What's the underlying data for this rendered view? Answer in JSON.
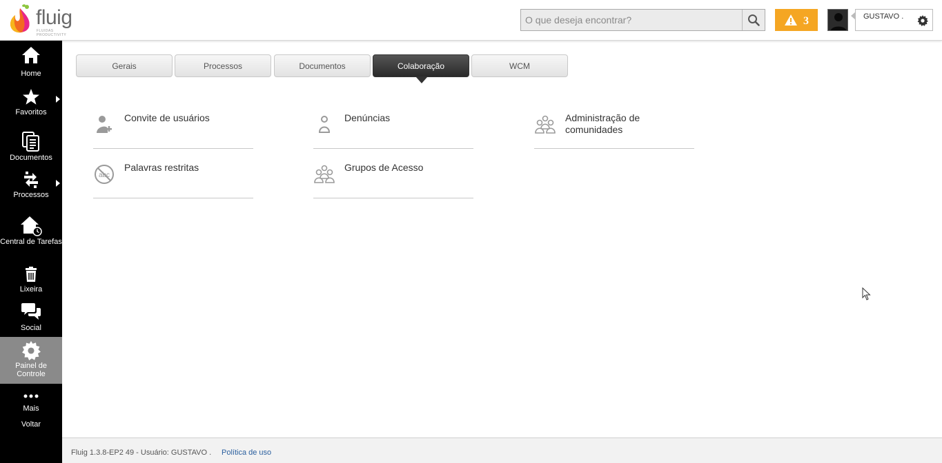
{
  "header": {
    "logo_text": "fluig",
    "logo_subtext": "FLUIDAS PRODUCTIVITY",
    "search_placeholder": "O que deseja encontrar?",
    "alert_count": "3",
    "user_name": "GUSTAVO ."
  },
  "sidebar": {
    "items": [
      {
        "label": "Home",
        "icon": "home-icon"
      },
      {
        "label": "Favoritos",
        "icon": "star-icon"
      },
      {
        "label": "Documentos",
        "icon": "documents-icon"
      },
      {
        "label": "Processos",
        "icon": "processes-icon"
      },
      {
        "label": "Central de Tarefas",
        "icon": "task-center-icon"
      },
      {
        "label": "Lixeira",
        "icon": "trash-icon"
      },
      {
        "label": "Social",
        "icon": "social-icon"
      },
      {
        "label": "Painel de Controle",
        "icon": "gear-icon"
      },
      {
        "label": "Mais",
        "icon": "more-icon"
      },
      {
        "label": "Voltar",
        "icon": ""
      }
    ]
  },
  "tabs": [
    {
      "label": "Gerais"
    },
    {
      "label": "Processos"
    },
    {
      "label": "Documentos"
    },
    {
      "label": "Colaboração",
      "active": true
    },
    {
      "label": "WCM"
    }
  ],
  "items": [
    {
      "label": "Convite de usuários",
      "icon": "user-add-icon"
    },
    {
      "label": "Denúncias",
      "icon": "user-icon"
    },
    {
      "label": "Administração de comunidades",
      "icon": "community-icon"
    },
    {
      "label": "Palavras restritas",
      "icon": "restricted-words-icon"
    },
    {
      "label": "Grupos de Acesso",
      "icon": "group-icon"
    }
  ],
  "footer": {
    "version": "Fluig 1.3.8-EP2 49 - Usuário: GUSTAVO .",
    "policy_link": "Política de uso"
  },
  "colors": {
    "alert": "#f5a623",
    "sidebar_bg": "#000000",
    "sidebar_active": "#8a8a8a",
    "tab_active": "#333333",
    "link": "#2a5f9e"
  }
}
